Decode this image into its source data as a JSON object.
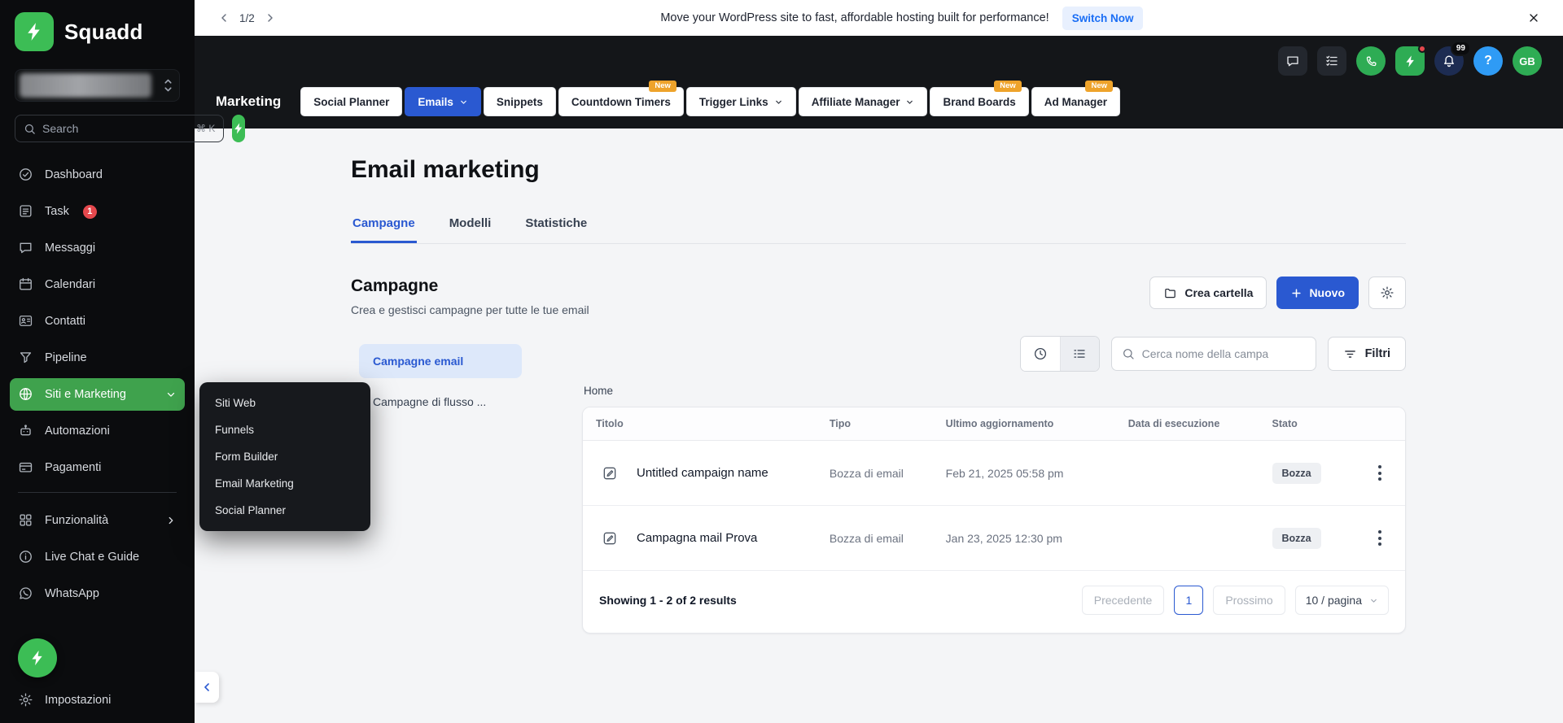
{
  "colors": {
    "accent_green": "#3CBD55",
    "active_green": "#3FA24D",
    "primary_blue": "#2A59D1",
    "link_blue": "#1A6EF5",
    "badge_amber": "#EEA32B",
    "danger_red": "#E5484D",
    "help_blue": "#2F9BF5"
  },
  "sidebar": {
    "brand": "Squadd",
    "search_placeholder": "Search",
    "search_shortcut": "⌘ K",
    "items": [
      {
        "label": "Dashboard"
      },
      {
        "label": "Task",
        "badge": "1"
      },
      {
        "label": "Messaggi"
      },
      {
        "label": "Calendari"
      },
      {
        "label": "Contatti"
      },
      {
        "label": "Pipeline"
      },
      {
        "label": "Siti e Marketing"
      },
      {
        "label": "Automazioni"
      },
      {
        "label": "Pagamenti"
      }
    ],
    "secondary_items": [
      {
        "label": "Funzionalità"
      },
      {
        "label": "Live Chat e Guide"
      },
      {
        "label": "WhatsApp"
      }
    ],
    "settings_label": "Impostazioni"
  },
  "flyout": {
    "items": [
      "Siti Web",
      "Funnels",
      "Form Builder",
      "Email Marketing",
      "Social Planner"
    ]
  },
  "banner": {
    "pager": "1/2",
    "message": "Move your WordPress site to fast, affordable hosting built for performance!",
    "cta": "Switch Now"
  },
  "topbar": {
    "notification_count": "99",
    "help_label": "?",
    "avatar_initials": "GB"
  },
  "marketing_nav": {
    "title": "Marketing",
    "tabs": [
      {
        "label": "Social Planner"
      },
      {
        "label": "Emails"
      },
      {
        "label": "Snippets"
      },
      {
        "label": "Countdown Timers",
        "badge": "New"
      },
      {
        "label": "Trigger Links"
      },
      {
        "label": "Affiliate Manager"
      },
      {
        "label": "Brand Boards",
        "badge": "New"
      },
      {
        "label": "Ad Manager",
        "badge": "New"
      }
    ]
  },
  "page": {
    "title": "Email marketing",
    "tabs": [
      {
        "label": "Campagne"
      },
      {
        "label": "Modelli"
      },
      {
        "label": "Statistiche"
      }
    ],
    "section_title": "Campagne",
    "section_subtitle": "Crea e gestisci campagne per tutte le tue email",
    "create_folder_label": "Crea cartella",
    "new_label": "Nuovo",
    "left_tabs": [
      {
        "label": "Campagne email"
      },
      {
        "label": "Campagne di flusso ..."
      }
    ],
    "search_placeholder": "Cerca nome della campa",
    "filter_label": "Filtri",
    "breadcrumb": "Home",
    "table": {
      "columns": [
        "Titolo",
        "Tipo",
        "Ultimo aggiornamento",
        "Data di esecuzione",
        "Stato"
      ],
      "rows": [
        {
          "title": "Untitled campaign name",
          "type": "Bozza di email",
          "updated": "Feb 21, 2025 05:58 pm",
          "execution": "",
          "status": "Bozza"
        },
        {
          "title": "Campagna mail Prova",
          "type": "Bozza di email",
          "updated": "Jan 23, 2025 12:30 pm",
          "execution": "",
          "status": "Bozza"
        }
      ],
      "footer": {
        "summary": "Showing 1 - 2 of 2 results",
        "prev_label": "Precedente",
        "current_page": "1",
        "next_label": "Prossimo",
        "page_size": "10 / pagina"
      }
    }
  }
}
